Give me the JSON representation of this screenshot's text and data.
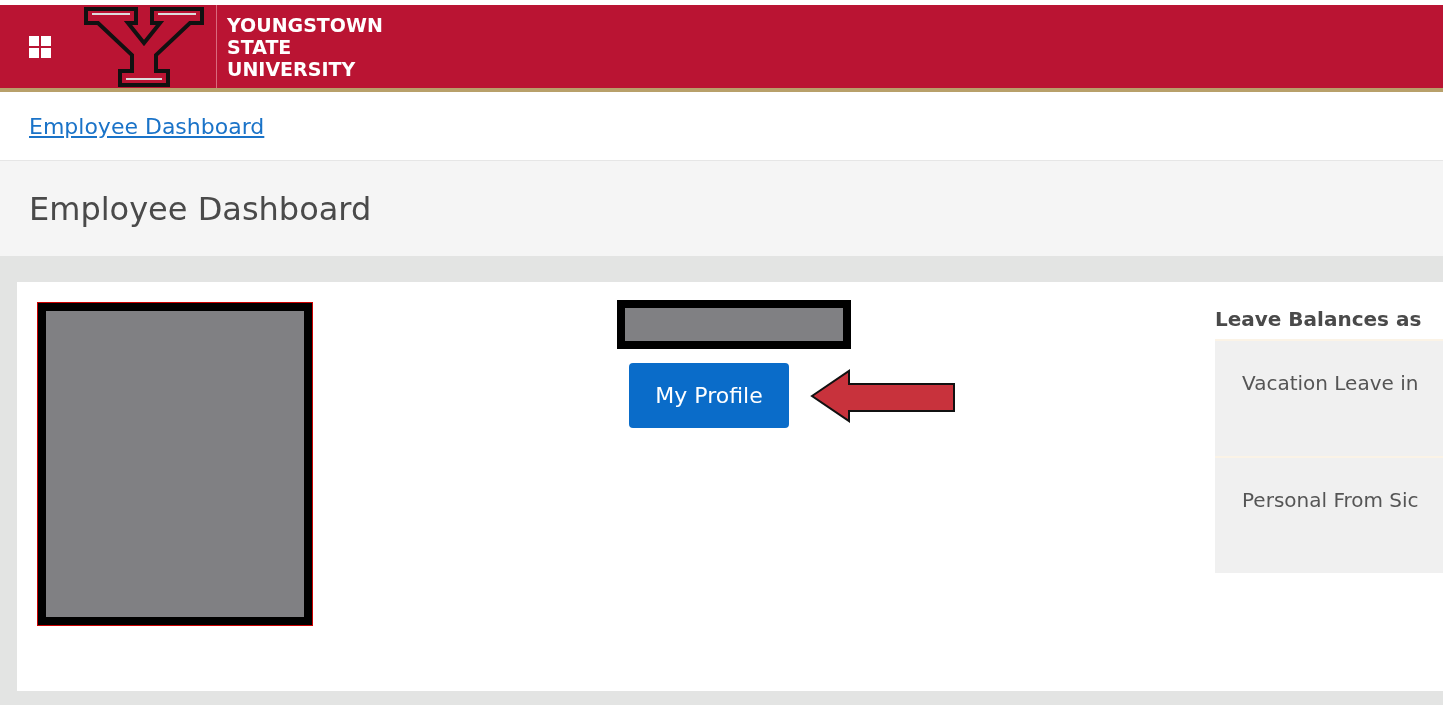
{
  "header": {
    "logo_lines": [
      "YOUNGSTOWN",
      "STATE",
      "UNIVERSITY"
    ]
  },
  "breadcrumb": {
    "link": "Employee Dashboard"
  },
  "page_title": "Employee Dashboard",
  "profile": {
    "button": "My Profile"
  },
  "leave_balances": {
    "heading": "Leave Balances as",
    "items": [
      {
        "label": "Vacation Leave in"
      },
      {
        "label": "Personal From Sic"
      }
    ]
  }
}
